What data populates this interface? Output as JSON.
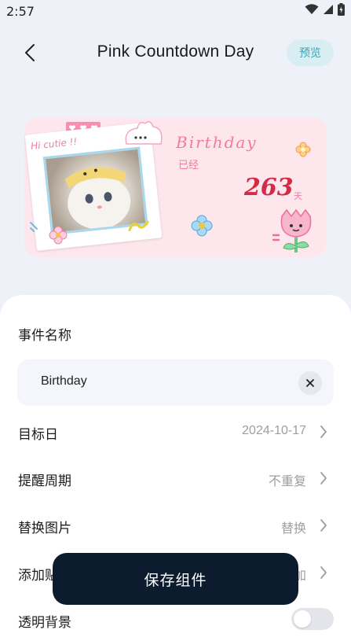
{
  "status_bar": {
    "time": "2:57"
  },
  "nav": {
    "title": "Pink Countdown Day",
    "preview_label": "预览"
  },
  "widget": {
    "greeting": "Hi cutie !!",
    "event_title": "Birthday",
    "elapsed_label": "已经",
    "count": "263",
    "unit": "天",
    "colors": {
      "card_bg": "#fde6ec",
      "accent": "#d32a45"
    }
  },
  "form": {
    "event_name_label": "事件名称",
    "event_name_value": "Birthday",
    "rows": [
      {
        "label": "目标日",
        "value": "2024-10-17"
      },
      {
        "label": "提醒周期",
        "value": "不重复"
      },
      {
        "label": "替换图片",
        "value": "替换"
      },
      {
        "label": "添加贴纸",
        "value": "添加"
      }
    ],
    "transparent_bg_label": "透明背景",
    "transparent_bg_on": false
  },
  "save_button": {
    "label": "保存组件"
  }
}
